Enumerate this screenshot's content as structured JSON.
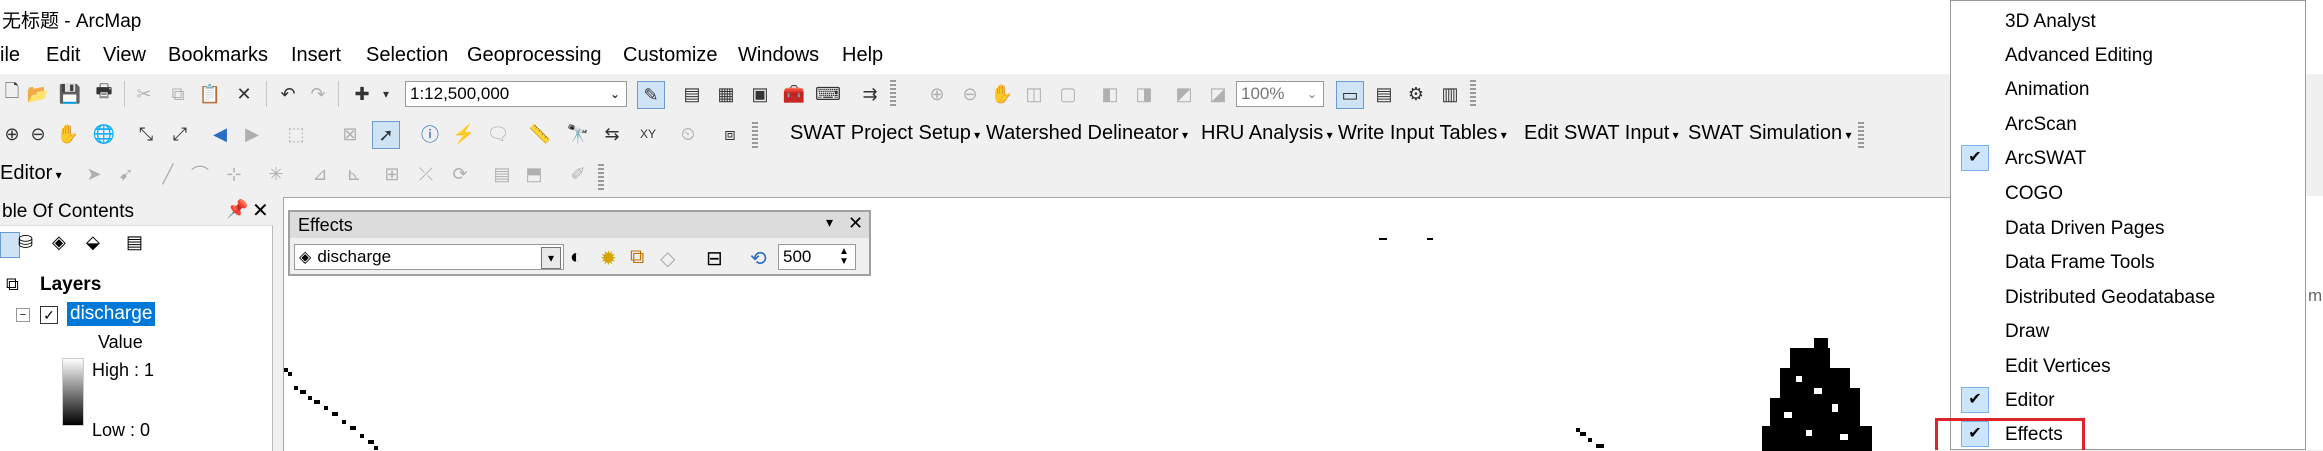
{
  "window": {
    "title": "无标题 - ArcMap"
  },
  "menubar": [
    "ile",
    "Edit",
    "View",
    "Bookmarks",
    "Insert",
    "Selection",
    "Geoprocessing",
    "Customize",
    "Windows",
    "Help"
  ],
  "toolbar1": {
    "scale_value": "1:12,500,000",
    "zoom_value": "100%"
  },
  "toolbar2": {
    "swat": [
      "SWAT Project Setup",
      "Watershed Delineator",
      "HRU Analysis",
      "Write Input Tables",
      "Edit SWAT Input",
      "SWAT Simulation"
    ]
  },
  "toolbar3": {
    "editor_label": "Editor"
  },
  "toc": {
    "title": "ble Of Contents",
    "layers_label": "Layers",
    "layer_name": "discharge",
    "legend_title": "Value",
    "high_label": "High : 1",
    "low_label": "Low : 0"
  },
  "effects": {
    "title": "Effects",
    "layer_value": "discharge",
    "transparency_value": "500"
  },
  "dropdown": {
    "items": [
      {
        "label": "3D Analyst",
        "checked": false
      },
      {
        "label": "Advanced Editing",
        "checked": false
      },
      {
        "label": "Animation",
        "checked": false
      },
      {
        "label": "ArcScan",
        "checked": false
      },
      {
        "label": "ArcSWAT",
        "checked": true
      },
      {
        "label": "COGO",
        "checked": false
      },
      {
        "label": "Data Driven Pages",
        "checked": false
      },
      {
        "label": "Data Frame Tools",
        "checked": false
      },
      {
        "label": "Distributed Geodatabase",
        "checked": false
      },
      {
        "label": "Draw",
        "checked": false
      },
      {
        "label": "Edit Vertices",
        "checked": false
      },
      {
        "label": "Editor",
        "checked": true
      },
      {
        "label": "Effects",
        "checked": true
      }
    ]
  },
  "right_edge_text": "mp",
  "colors": {
    "highlight": "#e0242b",
    "selection": "#0078d7"
  }
}
